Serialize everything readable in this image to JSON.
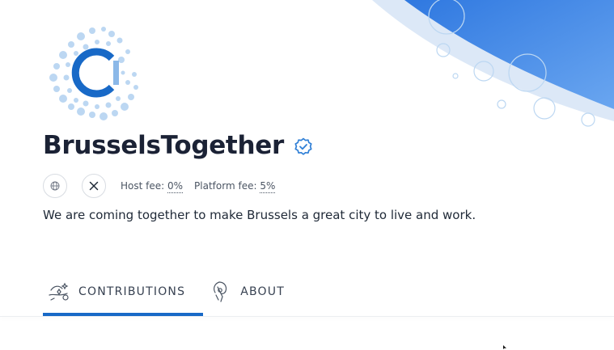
{
  "collective": {
    "name": "BrusselsTogether",
    "description": "We are coming together to make Brussels a great city to live and work.",
    "verified": true
  },
  "fees": {
    "host_label": "Host fee:",
    "host_value": "0%",
    "platform_label": "Platform fee:",
    "platform_value": "5%"
  },
  "links": {
    "website_icon": "globe-icon",
    "twitter_icon": "x-twitter-icon"
  },
  "tabs": [
    {
      "label": "CONTRIBUTIONS",
      "icon": "contributions-icon",
      "active": true
    },
    {
      "label": "ABOUT",
      "icon": "about-icon",
      "active": false
    }
  ],
  "colors": {
    "accent": "#1869c7",
    "hero_blue": "#3b83e6",
    "bubble": "#bcd7f2"
  }
}
